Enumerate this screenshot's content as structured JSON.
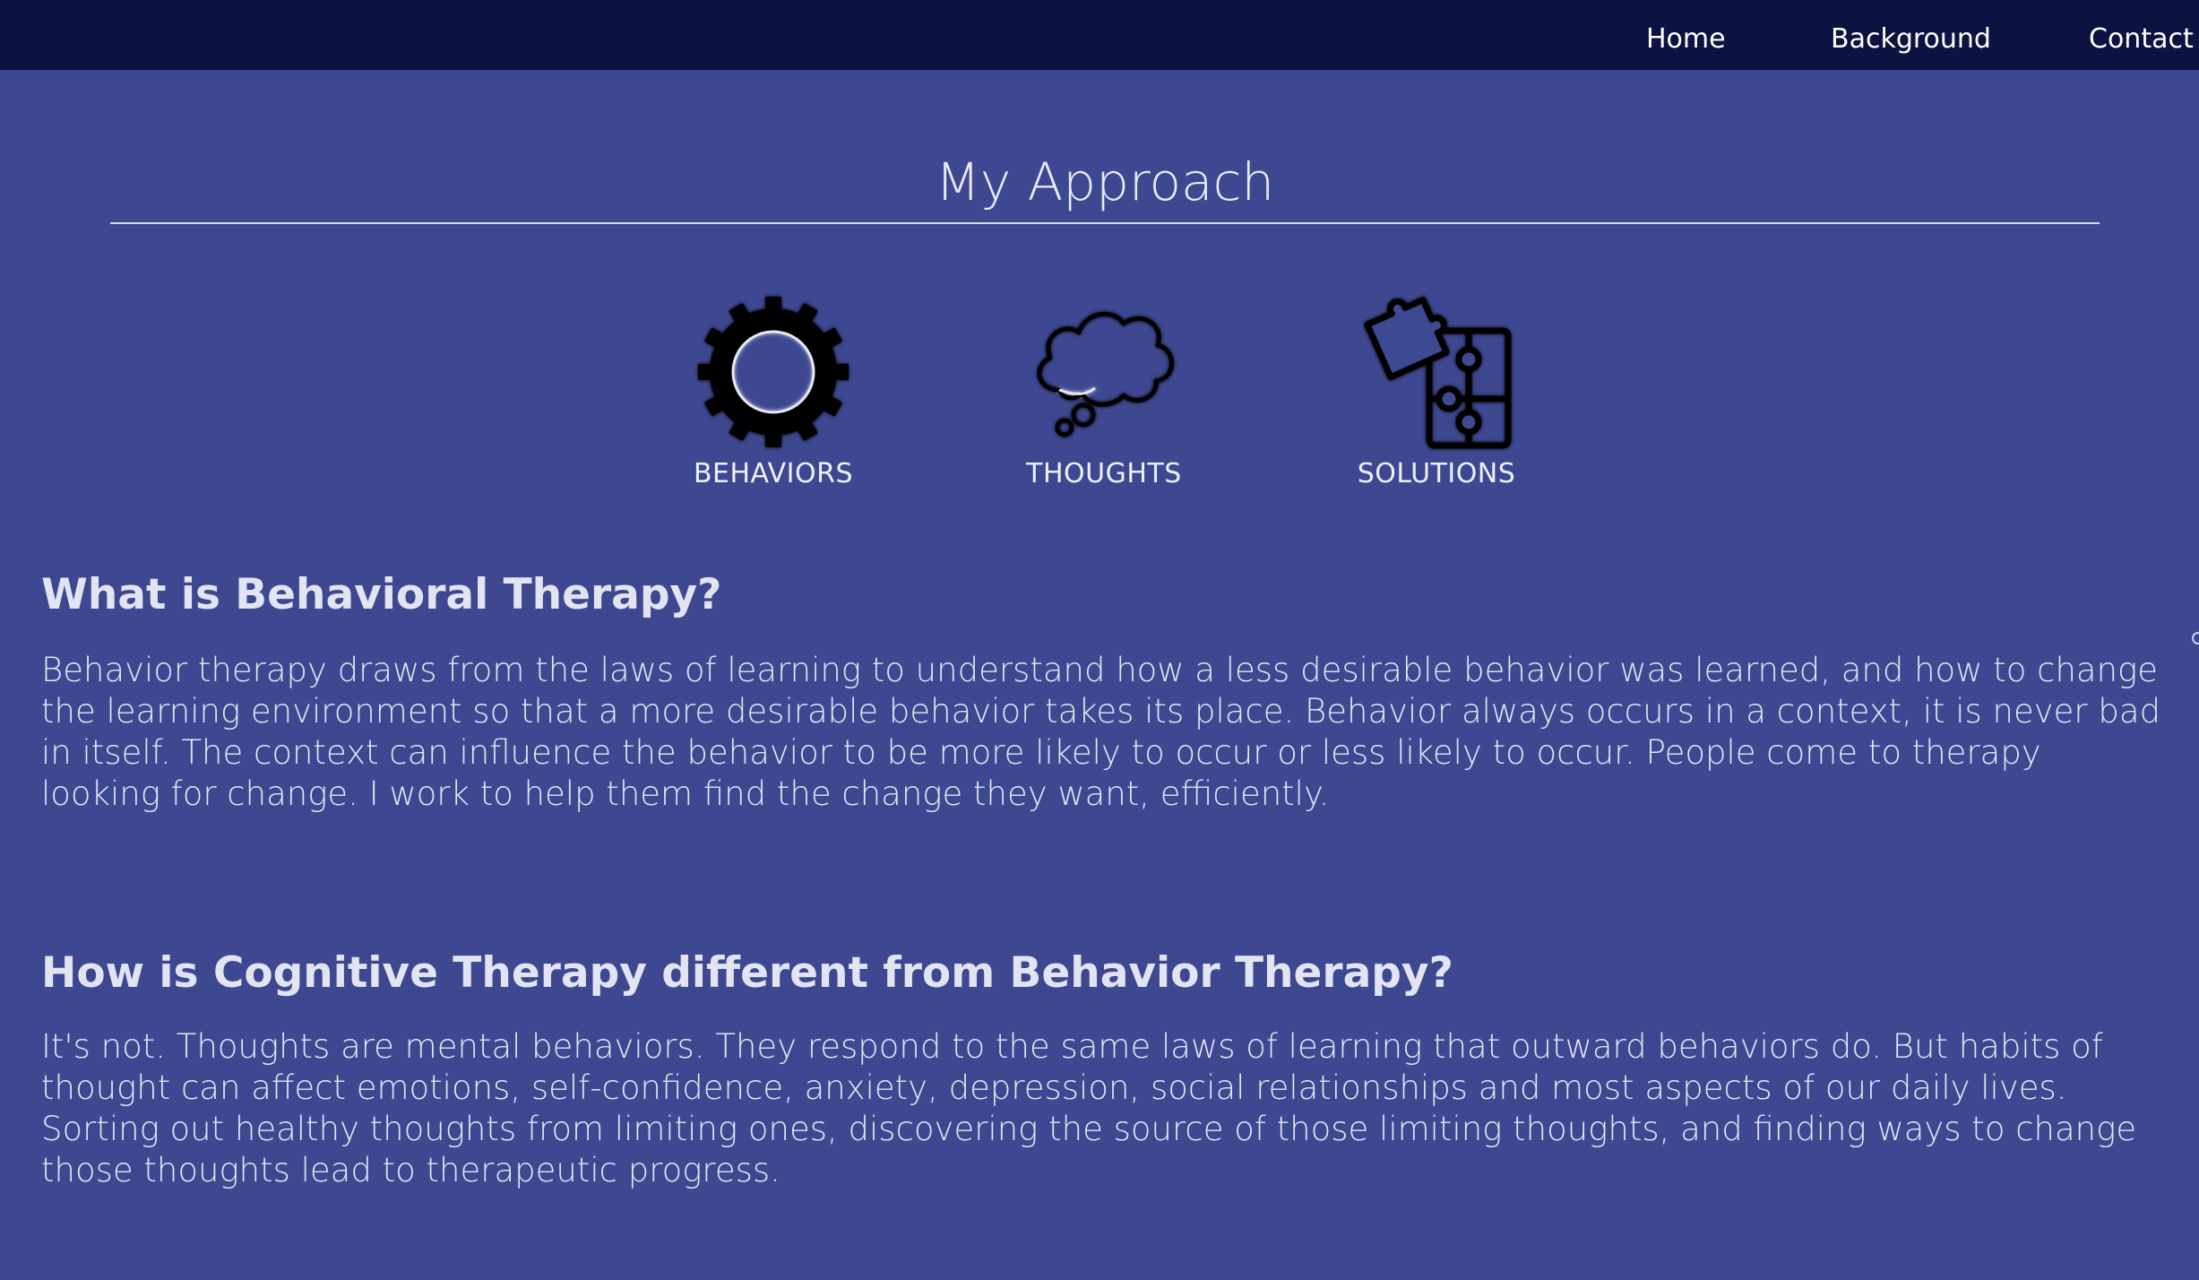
{
  "nav": {
    "items": [
      {
        "label": "Home"
      },
      {
        "label": "Background"
      },
      {
        "label": "Contact"
      }
    ]
  },
  "main": {
    "title": "My Approach",
    "approach_items": [
      {
        "label": "BEHAVIORS",
        "icon": "gear-icon"
      },
      {
        "label": "THOUGHTS",
        "icon": "thought-bubble-icon"
      },
      {
        "label": "SOLUTIONS",
        "icon": "puzzle-icon"
      }
    ],
    "sections": [
      {
        "heading": "What is Behavioral Therapy?",
        "body": "Behavior therapy draws from the laws of learning to understand how a less desirable behavior was learned, and how to change the learning environment so that a more desirable behavior takes its place. Behavior always occurs in a context, it is never bad in itself. The context can influence the behavior to be more likely to occur or less likely to occur. People come to therapy looking for change. I work to help them find the change they want, efficiently."
      },
      {
        "heading": "How is Cognitive Therapy different from Behavior Therapy?",
        "body": "It's not. Thoughts are mental behaviors. They respond to the same laws of learning that outward behaviors do. But habits of thought can affect emotions, self-confidence, anxiety, depression, social relationships and most aspects of our daily lives. Sorting out healthy thoughts from limiting ones, discovering the source of those limiting thoughts, and finding ways to change those thoughts lead to therapeutic progress."
      }
    ]
  },
  "colors": {
    "page_background": "#3d4891",
    "nav_background": "#0c1340",
    "text": "#e4e6f2",
    "icon": "#000000"
  }
}
